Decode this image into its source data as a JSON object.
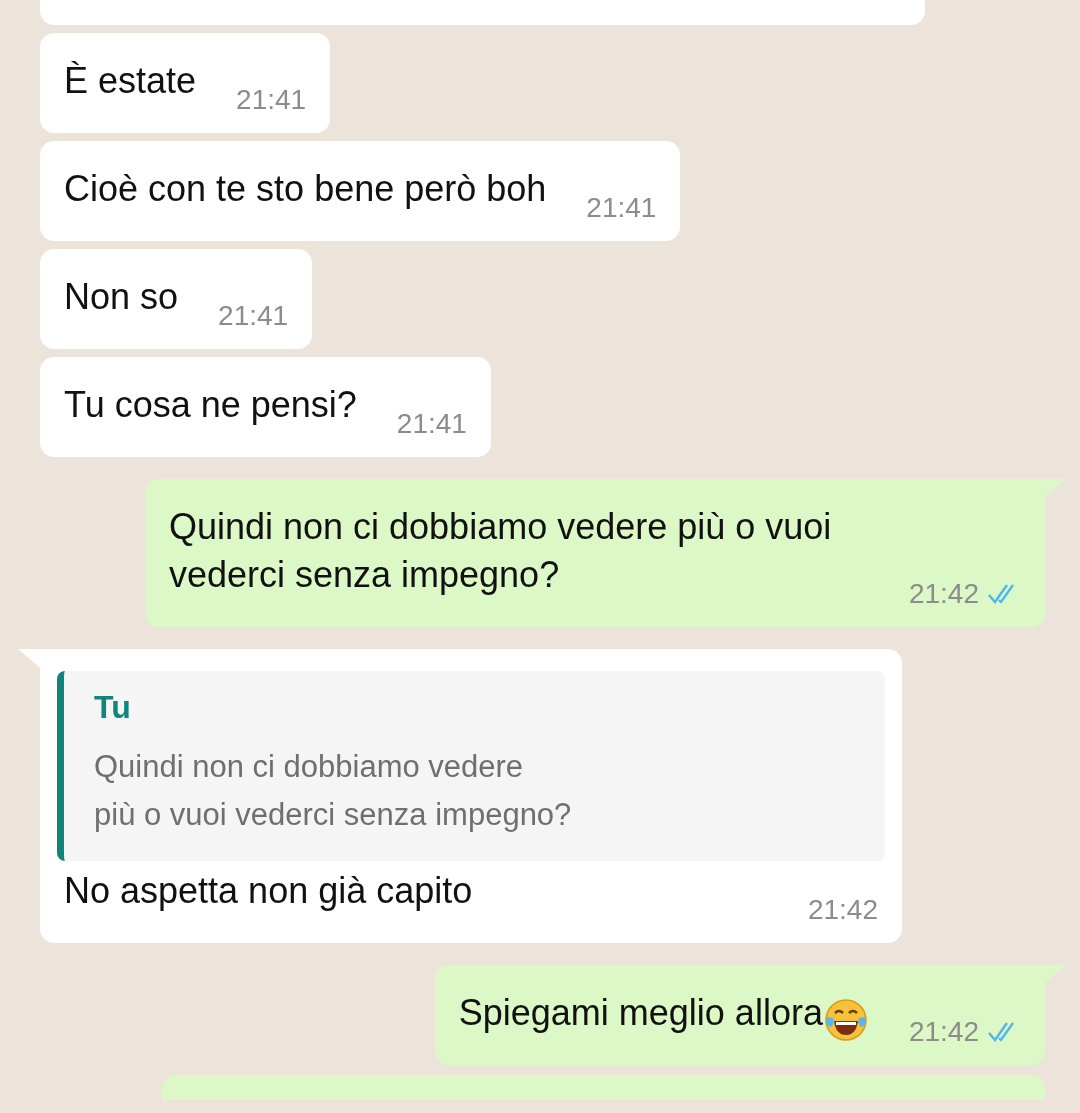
{
  "messages": [
    {
      "kind": "cut",
      "outgoing": false,
      "tail": false
    },
    {
      "kind": "text",
      "outgoing": false,
      "tail": false,
      "text": "È estate",
      "time": "21:41"
    },
    {
      "kind": "text",
      "outgoing": false,
      "tail": false,
      "text": "Cioè con te sto bene però boh",
      "time": "21:41"
    },
    {
      "kind": "text",
      "outgoing": false,
      "tail": false,
      "text": "Non so",
      "time": "21:41"
    },
    {
      "kind": "text",
      "outgoing": false,
      "tail": false,
      "text": "Tu cosa ne pensi?",
      "time": "21:41"
    },
    {
      "kind": "text",
      "outgoing": true,
      "tail": true,
      "text": "Quindi non ci dobbiamo vedere più o vuoi vederci senza impegno?",
      "time": "21:42",
      "read": true
    },
    {
      "kind": "reply",
      "outgoing": false,
      "tail": true,
      "quote": {
        "author": "Tu",
        "text": "Quindi non ci dobbiamo vedere\npiù o vuoi vederci senza impegno?"
      },
      "text": "No aspetta non già capito",
      "time": "21:42"
    },
    {
      "kind": "text",
      "outgoing": true,
      "tail": true,
      "text": "Spiegami meglio allora",
      "laughing_emoji": true,
      "time": "21:42",
      "read": true
    },
    {
      "kind": "cut",
      "outgoing": true,
      "tail": false
    }
  ]
}
